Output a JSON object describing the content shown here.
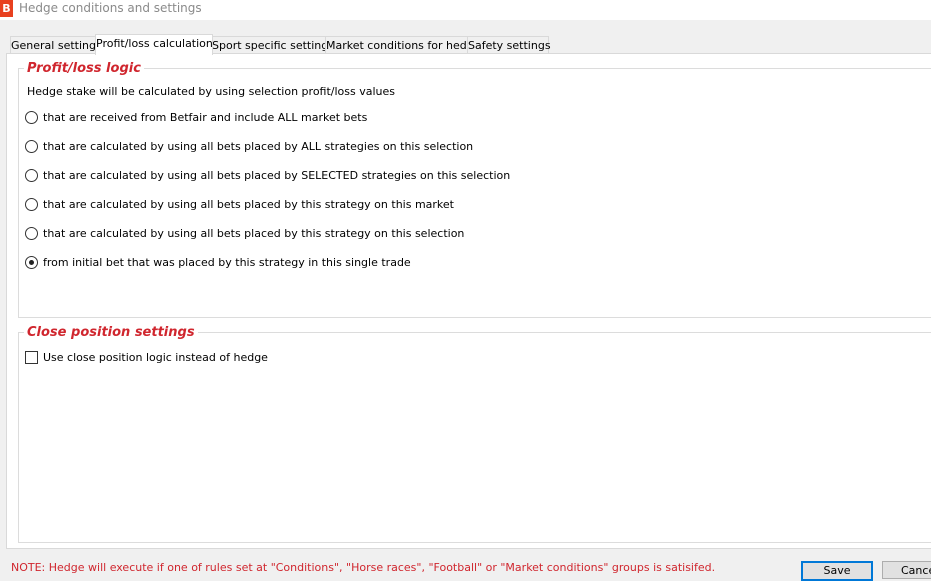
{
  "window": {
    "title": "Hedge conditions and settings",
    "icon_letter": "B",
    "icon_name": "app-logo-icon",
    "accent_color": "#e8401f"
  },
  "tabs": [
    {
      "label": "General settings"
    },
    {
      "label": "Profit/loss calculation",
      "selected": true
    },
    {
      "label": "Sport specific settings"
    },
    {
      "label": "Market conditions for hedge"
    },
    {
      "label": "Safety settings"
    }
  ],
  "profit_loss": {
    "legend": "Profit/loss logic",
    "description": "Hedge stake will be calculated by using selection profit/loss values",
    "options": [
      {
        "label": "that are received from Betfair and include ALL market bets",
        "checked": false
      },
      {
        "label": "that are calculated by using all bets placed by ALL strategies on this selection",
        "checked": false
      },
      {
        "label": "that are calculated by using all bets placed by SELECTED strategies on this selection",
        "checked": false
      },
      {
        "label": "that are calculated by using all bets placed by this strategy on this market",
        "checked": false
      },
      {
        "label": "that are calculated by using all bets placed by this strategy on this selection",
        "checked": false
      },
      {
        "label": "from initial bet that was placed by this strategy in this single trade",
        "checked": true
      }
    ]
  },
  "close_position": {
    "legend": "Close position settings",
    "checkbox_label": "Use close position logic instead of hedge",
    "checked": false
  },
  "footer": {
    "note": "NOTE: Hedge will execute if one of rules set at \"Conditions\", \"Horse races\", \"Football\" or \"Market conditions\" groups is satisifed.",
    "save_label": "Save",
    "cancel_label": "Cancel"
  },
  "colors": {
    "legend": "#d0262e",
    "note": "#d0262e"
  }
}
